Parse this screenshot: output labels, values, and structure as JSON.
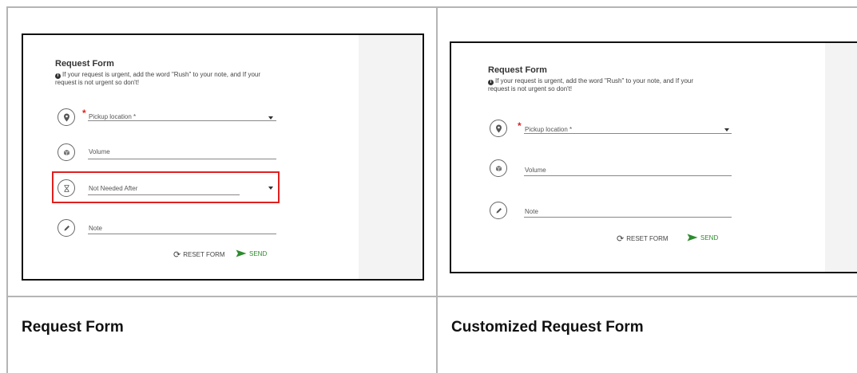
{
  "left": {
    "caption": "Request Form",
    "form": {
      "title": "Request Form",
      "info": "If your request is urgent, add the word \"Rush\" to your note, and If your request is not urgent so don't!",
      "fields": {
        "pickup": "Pickup location *",
        "volume": "Volume",
        "not_needed_after": "Not Needed After",
        "note": "Note"
      },
      "reset_label": "RESET FORM",
      "send_label": "SEND"
    }
  },
  "right": {
    "caption": "Customized Request Form",
    "form": {
      "title": "Request Form",
      "info": "If your request is urgent, add the word \"Rush\" to your note, and If your request is not urgent so don't!",
      "fields": {
        "pickup": "Pickup location *",
        "volume": "Volume",
        "note": "Note"
      },
      "reset_label": "RESET FORM",
      "send_label": "SEND"
    }
  },
  "icons": {
    "info": "info-icon",
    "location": "map-pin-icon",
    "volume": "box-icon",
    "date": "hourglass-icon",
    "note": "pencil-icon",
    "reset": "refresh-icon",
    "send": "send-arrow-icon"
  },
  "colors": {
    "required_star": "#dd2222",
    "highlight_border": "#e02020",
    "send_green": "#2e8b2e"
  }
}
